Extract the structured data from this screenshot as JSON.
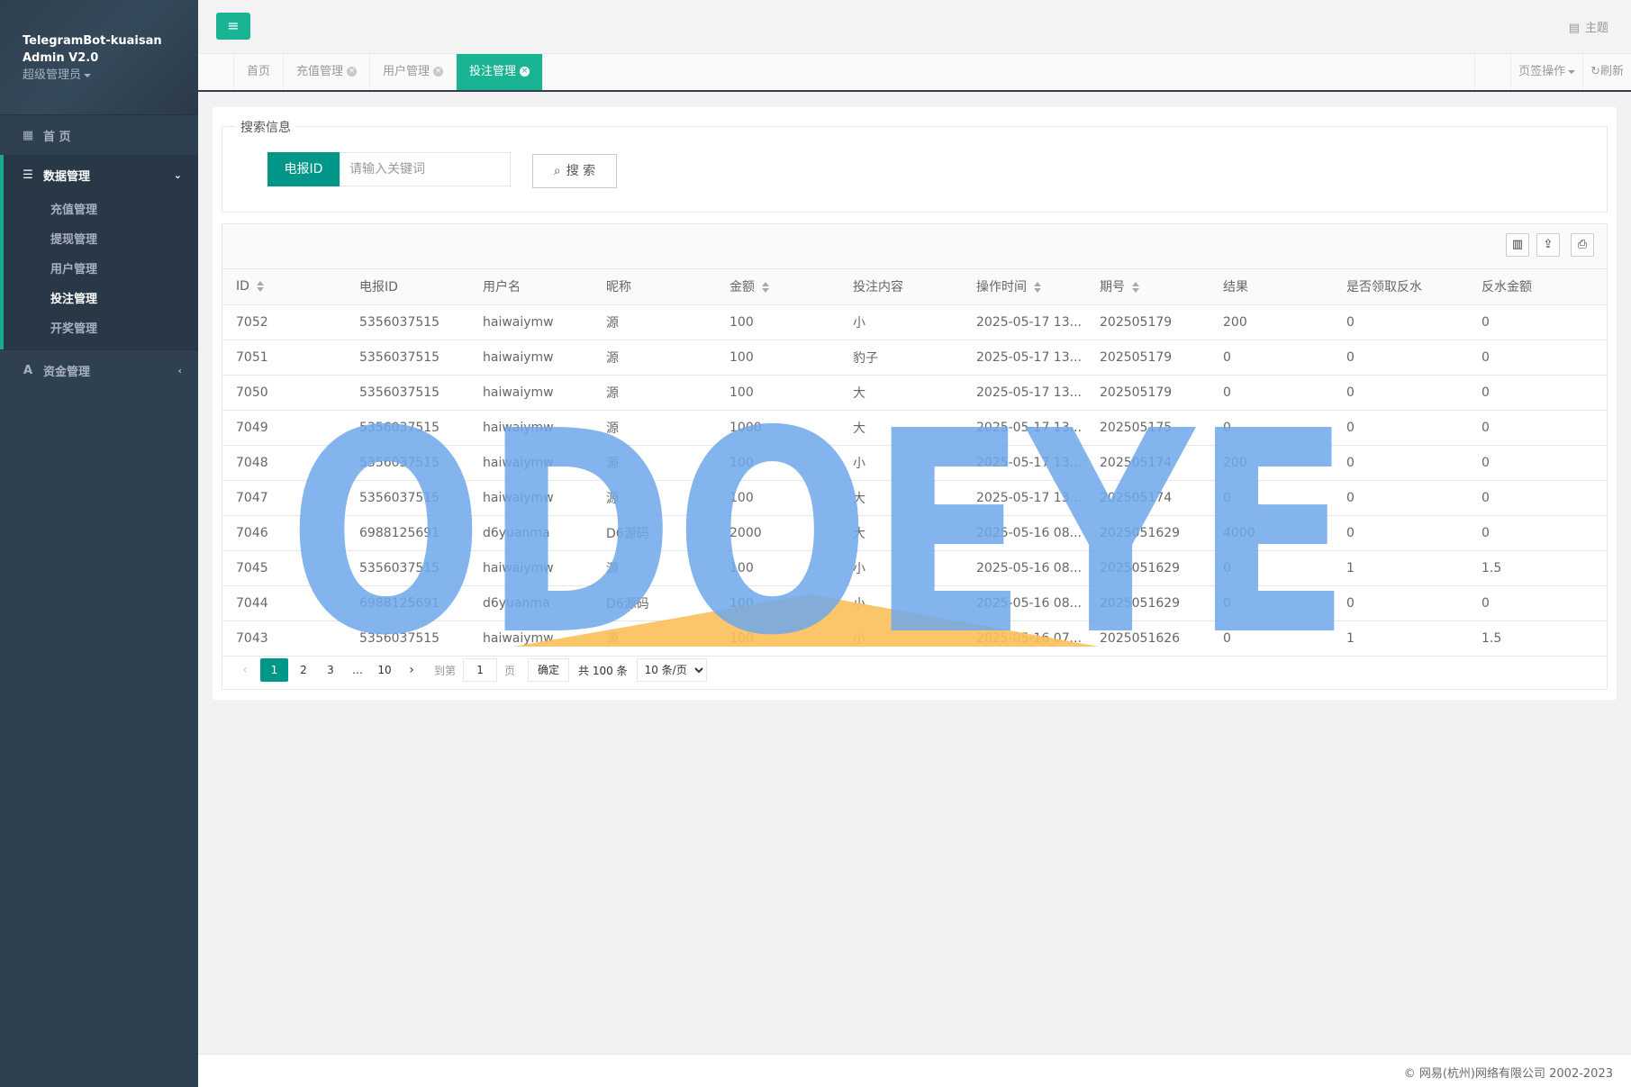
{
  "sidebar": {
    "brand_line1": "TelegramBot-kuaisan",
    "brand_line2": "Admin V2.0",
    "role": "超级管理员",
    "home": "首 页",
    "group": "数据管理",
    "sub_items": [
      "充值管理",
      "提现管理",
      "用户管理",
      "投注管理",
      "开奖管理"
    ],
    "funds": "资金管理"
  },
  "topbar": {
    "theme": "主题"
  },
  "tabs": [
    {
      "label": "首页"
    },
    {
      "label": "充值管理"
    },
    {
      "label": "用户管理"
    },
    {
      "label": "投注管理"
    }
  ],
  "tab_right": {
    "page_ops": "页签操作",
    "refresh": "刷新"
  },
  "search": {
    "legend": "搜索信息",
    "label": "电报ID",
    "placeholder": "请输入关键词",
    "button": "搜 索"
  },
  "table": {
    "headers": [
      "ID",
      "电报ID",
      "用户名",
      "昵称",
      "金额",
      "投注内容",
      "操作时间",
      "期号",
      "结果",
      "是否领取反水",
      "反水金额"
    ],
    "rows": [
      [
        "7052",
        "5356037515",
        "haiwaiymw",
        "源",
        "100",
        "小",
        "2025-05-17 13...",
        "202505179",
        "200",
        "0",
        "0"
      ],
      [
        "7051",
        "5356037515",
        "haiwaiymw",
        "源",
        "100",
        "豹子",
        "2025-05-17 13...",
        "202505179",
        "0",
        "0",
        "0"
      ],
      [
        "7050",
        "5356037515",
        "haiwaiymw",
        "源",
        "100",
        "大",
        "2025-05-17 13...",
        "202505179",
        "0",
        "0",
        "0"
      ],
      [
        "7049",
        "5356037515",
        "haiwaiymw",
        "源",
        "1000",
        "大",
        "2025-05-17 13...",
        "202505175",
        "0",
        "0",
        "0"
      ],
      [
        "7048",
        "5356037515",
        "haiwaiymw",
        "源",
        "100",
        "小",
        "2025-05-17 13...",
        "202505174",
        "200",
        "0",
        "0"
      ],
      [
        "7047",
        "5356037515",
        "haiwaiymw",
        "源",
        "100",
        "大",
        "2025-05-17 13...",
        "202505174",
        "0",
        "0",
        "0"
      ],
      [
        "7046",
        "6988125691",
        "d6yuanma",
        "D6源码",
        "2000",
        "大",
        "2025-05-16 08...",
        "2025051629",
        "4000",
        "0",
        "0"
      ],
      [
        "7045",
        "5356037515",
        "haiwaiymw",
        "源",
        "100",
        "小",
        "2025-05-16 08...",
        "2025051629",
        "0",
        "1",
        "1.5"
      ],
      [
        "7044",
        "6988125691",
        "d6yuanma",
        "D6源码",
        "100",
        "小",
        "2025-05-16 08...",
        "2025051629",
        "0",
        "0",
        "0"
      ],
      [
        "7043",
        "5356037515",
        "haiwaiymw",
        "源",
        "100",
        "小",
        "2025-05-16 07...",
        "2025051626",
        "0",
        "1",
        "1.5"
      ]
    ]
  },
  "pager": {
    "pages": [
      "1",
      "2",
      "3",
      "…",
      "10"
    ],
    "goto_label": "到第",
    "goto_value": "1",
    "page_unit": "页",
    "confirm": "确定",
    "total": "共 100 条",
    "per_page": "10 条/页"
  },
  "watermark": {
    "text": "ODOEYE",
    "color": "#6fa8ea",
    "accent": "#fbbf5a"
  },
  "footer": "© 网易(杭州)网络有限公司 2002-2023",
  "colors": {
    "sidebar": "#2f4050",
    "accent": "#1ab394",
    "primary": "#009688"
  }
}
